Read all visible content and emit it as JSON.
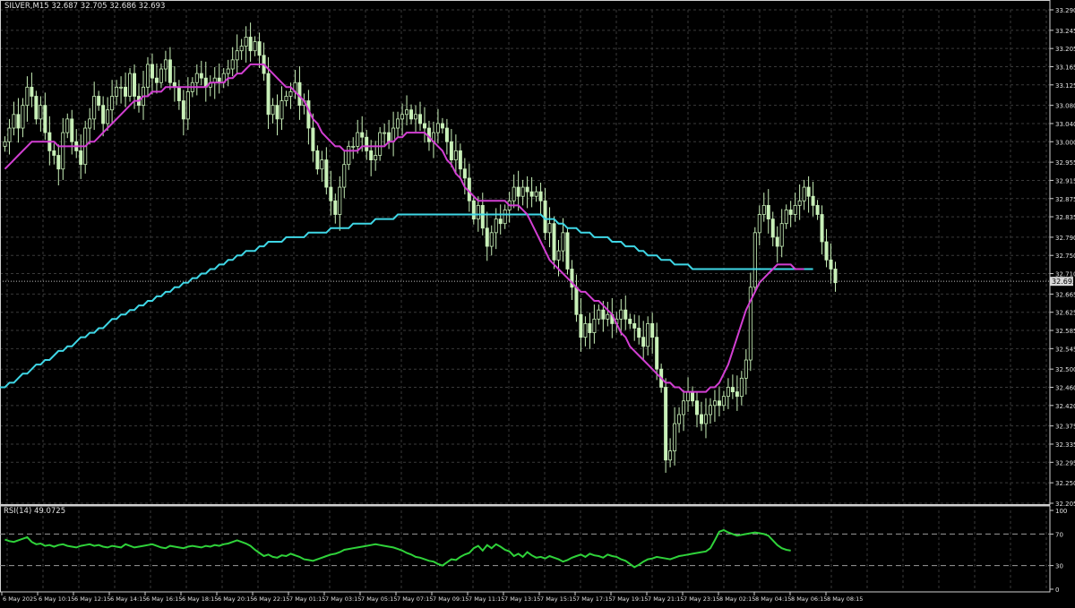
{
  "window": {
    "symbol_line": "SILVER,M15  32.687 32.705 32.686 32.693",
    "rsi_line": "RSI(14) 49.0725",
    "current_price": "32.693"
  },
  "colors": {
    "background": "#000000",
    "grid": "#3a3a3a",
    "axis_text": "#e0e0e0",
    "candle": "#c8f0b8",
    "ma_fast": "#d23fd2",
    "ma_slow": "#3fd7e6",
    "rsi_line": "#2fd23a",
    "level_line": "#9a9a9a",
    "price_tag_bg": "#d8d8d8"
  },
  "chart_data": [
    {
      "type": "candlestick",
      "title": "SILVER,M15",
      "ylim": [
        32.205,
        33.29
      ],
      "y_ticks": [
        "33.290",
        "33.245",
        "33.205",
        "33.165",
        "33.125",
        "33.080",
        "33.040",
        "33.000",
        "32.955",
        "32.915",
        "32.875",
        "32.835",
        "32.790",
        "32.750",
        "32.710",
        "32.665",
        "32.625",
        "32.585",
        "32.545",
        "32.500",
        "32.460",
        "32.420",
        "32.375",
        "32.335",
        "32.295",
        "32.250",
        "32.205"
      ],
      "x_ticks": [
        "6 May 2025",
        "6 May 10:15",
        "6 May 12:15",
        "6 May 14:15",
        "6 May 16:15",
        "6 May 18:15",
        "6 May 20:15",
        "6 May 22:15",
        "7 May 01:15",
        "7 May 03:15",
        "7 May 05:15",
        "7 May 07:15",
        "7 May 09:15",
        "7 May 11:15",
        "7 May 13:15",
        "7 May 15:15",
        "7 May 17:15",
        "7 May 19:15",
        "7 May 21:15",
        "7 May 23:15",
        "8 May 02:15",
        "8 May 04:15",
        "8 May 06:15",
        "8 May 08:15"
      ],
      "close": [
        33.0,
        33.03,
        33.06,
        33.03,
        33.08,
        33.12,
        33.1,
        33.05,
        33.08,
        33.02,
        32.98,
        32.97,
        32.94,
        33.02,
        33.05,
        33.0,
        32.98,
        32.95,
        33.03,
        33.05,
        33.1,
        33.08,
        33.04,
        33.07,
        33.1,
        33.12,
        33.12,
        33.1,
        33.15,
        33.1,
        33.08,
        33.12,
        33.17,
        33.14,
        33.13,
        33.16,
        33.18,
        33.13,
        33.12,
        33.09,
        33.05,
        33.11,
        33.13,
        33.15,
        33.14,
        33.12,
        33.13,
        33.14,
        33.13,
        33.15,
        33.16,
        33.18,
        33.2,
        33.21,
        33.23,
        33.2,
        33.22,
        33.19,
        33.15,
        33.06,
        33.08,
        33.05,
        33.09,
        33.1,
        33.11,
        33.13,
        33.08,
        33.09,
        33.03,
        32.98,
        32.94,
        32.96,
        32.9,
        32.87,
        32.84,
        32.9,
        32.95,
        32.99,
        32.99,
        33.02,
        33.01,
        32.98,
        32.96,
        32.97,
        33.02,
        33.02,
        33.0,
        33.03,
        33.05,
        33.06,
        33.07,
        33.05,
        33.06,
        33.04,
        33.03,
        33.0,
        33.02,
        33.04,
        33.03,
        33.0,
        32.96,
        32.98,
        32.94,
        32.92,
        32.87,
        32.83,
        32.86,
        32.81,
        32.77,
        32.8,
        32.83,
        32.82,
        32.85,
        32.87,
        32.9,
        32.88,
        32.9,
        32.89,
        32.88,
        32.89,
        32.87,
        32.8,
        32.82,
        32.74,
        32.76,
        32.8,
        32.72,
        32.68,
        32.62,
        32.57,
        32.6,
        32.58,
        32.61,
        32.63,
        32.61,
        32.62,
        32.6,
        32.61,
        32.63,
        32.61,
        32.6,
        32.59,
        32.57,
        32.55,
        32.6,
        32.57,
        32.5,
        32.46,
        32.3,
        32.32,
        32.38,
        32.4,
        32.43,
        32.45,
        32.43,
        32.4,
        32.38,
        32.4,
        32.42,
        32.43,
        32.42,
        32.44,
        32.46,
        32.45,
        32.44,
        32.48,
        32.52,
        32.68,
        32.8,
        32.84,
        32.86,
        32.83,
        32.79,
        32.77,
        32.82,
        32.85,
        32.84,
        32.86,
        32.87,
        32.9,
        32.88,
        32.86,
        32.84,
        32.78,
        32.74,
        32.72,
        32.69
      ],
      "ma_fast": [
        32.94,
        32.95,
        32.96,
        32.97,
        32.98,
        32.99,
        33.0,
        33.0,
        33.0,
        33.0,
        33.0,
        33.0,
        32.99,
        32.99,
        32.99,
        32.99,
        32.99,
        32.99,
        32.99,
        33.0,
        33.0,
        33.01,
        33.02,
        33.03,
        33.04,
        33.05,
        33.06,
        33.07,
        33.08,
        33.09,
        33.09,
        33.1,
        33.1,
        33.11,
        33.11,
        33.11,
        33.12,
        33.12,
        33.12,
        33.12,
        33.12,
        33.12,
        33.12,
        33.12,
        33.12,
        33.12,
        33.13,
        33.13,
        33.13,
        33.13,
        33.14,
        33.14,
        33.15,
        33.15,
        33.16,
        33.17,
        33.17,
        33.17,
        33.17,
        33.16,
        33.15,
        33.14,
        33.13,
        33.12,
        33.12,
        33.11,
        33.1,
        33.09,
        33.07,
        33.05,
        33.04,
        33.02,
        33.01,
        33.0,
        32.99,
        32.99,
        32.98,
        32.98,
        32.98,
        32.98,
        32.99,
        32.99,
        32.99,
        32.99,
        32.99,
        32.99,
        33.0,
        33.0,
        33.01,
        33.01,
        33.02,
        33.02,
        33.02,
        33.02,
        33.02,
        33.01,
        33.0,
        32.99,
        32.98,
        32.96,
        32.95,
        32.93,
        32.92,
        32.9,
        32.89,
        32.88,
        32.87,
        32.87,
        32.87,
        32.87,
        32.87,
        32.87,
        32.87,
        32.86,
        32.86,
        32.86,
        32.85,
        32.84,
        32.82,
        32.8,
        32.78,
        32.76,
        32.74,
        32.73,
        32.72,
        32.71,
        32.7,
        32.69,
        32.68,
        32.67,
        32.67,
        32.66,
        32.65,
        32.65,
        32.64,
        32.63,
        32.62,
        32.6,
        32.58,
        32.57,
        32.55,
        32.54,
        32.53,
        32.52,
        32.51,
        32.5,
        32.49,
        32.48,
        32.47,
        32.47,
        32.46,
        32.46,
        32.45,
        32.45,
        32.45,
        32.45,
        32.45,
        32.45,
        32.46,
        32.46,
        32.47,
        32.49,
        32.51,
        32.54,
        32.57,
        32.6,
        32.63,
        32.65,
        32.67,
        32.69,
        32.7,
        32.71,
        32.72,
        32.73,
        32.73,
        32.73,
        32.73,
        32.72,
        32.72,
        32.72
      ],
      "ma_slow": [
        32.46,
        32.47,
        32.47,
        32.48,
        32.49,
        32.49,
        32.5,
        32.51,
        32.51,
        32.52,
        32.52,
        32.53,
        32.54,
        32.54,
        32.55,
        32.55,
        32.56,
        32.57,
        32.57,
        32.58,
        32.58,
        32.59,
        32.59,
        32.6,
        32.61,
        32.61,
        32.62,
        32.62,
        32.63,
        32.63,
        32.64,
        32.64,
        32.65,
        32.65,
        32.66,
        32.66,
        32.67,
        32.67,
        32.68,
        32.68,
        32.69,
        32.69,
        32.7,
        32.7,
        32.71,
        32.71,
        32.72,
        32.72,
        32.73,
        32.73,
        32.74,
        32.74,
        32.75,
        32.75,
        32.76,
        32.76,
        32.76,
        32.77,
        32.77,
        32.78,
        32.78,
        32.78,
        32.78,
        32.79,
        32.79,
        32.79,
        32.79,
        32.79,
        32.8,
        32.8,
        32.8,
        32.8,
        32.8,
        32.81,
        32.81,
        32.81,
        32.81,
        32.81,
        32.82,
        32.82,
        32.82,
        32.82,
        32.82,
        32.83,
        32.83,
        32.83,
        32.83,
        32.83,
        32.84,
        32.84,
        32.84,
        32.84,
        32.84,
        32.84,
        32.84,
        32.84,
        32.84,
        32.84,
        32.84,
        32.84,
        32.84,
        32.84,
        32.84,
        32.84,
        32.84,
        32.84,
        32.84,
        32.84,
        32.84,
        32.84,
        32.84,
        32.84,
        32.84,
        32.84,
        32.84,
        32.84,
        32.84,
        32.84,
        32.84,
        32.84,
        32.84,
        32.83,
        32.83,
        32.83,
        32.82,
        32.82,
        32.81,
        32.81,
        32.81,
        32.8,
        32.8,
        32.8,
        32.79,
        32.79,
        32.79,
        32.79,
        32.78,
        32.78,
        32.78,
        32.77,
        32.77,
        32.77,
        32.76,
        32.76,
        32.75,
        32.75,
        32.75,
        32.74,
        32.74,
        32.74,
        32.73,
        32.73,
        32.73,
        32.73,
        32.72,
        32.72,
        32.72,
        32.72,
        32.72,
        32.72,
        32.72,
        32.72,
        32.72,
        32.72,
        32.72,
        32.72,
        32.72,
        32.72,
        32.72,
        32.72,
        32.72,
        32.72,
        32.72,
        32.72,
        32.72,
        32.72,
        32.72,
        32.72,
        32.72,
        32.72,
        32.72,
        32.72
      ],
      "current_price": 32.693
    },
    {
      "type": "line",
      "title": "RSI(14) 49.0725",
      "ylim": [
        0,
        100
      ],
      "y_ticks": [
        "100",
        "70",
        "30",
        "0"
      ],
      "levels": [
        70,
        30
      ],
      "values": [
        63,
        61,
        60,
        62,
        64,
        66,
        60,
        57,
        58,
        55,
        56,
        54,
        56,
        57,
        55,
        54,
        53,
        55,
        56,
        57,
        55,
        56,
        54,
        53,
        55,
        54,
        53,
        57,
        55,
        53,
        54,
        55,
        56,
        57,
        55,
        53,
        52,
        55,
        54,
        53,
        52,
        54,
        55,
        54,
        53,
        55,
        54,
        56,
        55,
        57,
        58,
        60,
        62,
        60,
        58,
        55,
        50,
        46,
        42,
        44,
        41,
        40,
        43,
        42,
        45,
        43,
        41,
        38,
        37,
        36,
        38,
        40,
        42,
        44,
        45,
        47,
        50,
        51,
        52,
        53,
        54,
        55,
        56,
        57,
        56,
        55,
        54,
        53,
        51,
        49,
        46,
        44,
        41,
        40,
        38,
        36,
        35,
        32,
        30,
        34,
        38,
        37,
        41,
        44,
        46,
        52,
        55,
        49,
        56,
        52,
        57,
        54,
        50,
        48,
        42,
        45,
        41,
        47,
        43,
        40,
        41,
        39,
        42,
        40,
        38,
        35,
        37,
        40,
        42,
        44,
        41,
        45,
        43,
        42,
        40,
        44,
        42,
        41,
        38,
        36,
        32,
        28,
        31,
        35,
        38,
        39,
        41,
        40,
        39,
        38,
        40,
        42,
        43,
        44,
        45,
        46,
        47,
        48,
        52,
        62,
        73,
        75,
        72,
        70,
        68,
        69,
        70,
        71,
        72,
        71,
        70,
        68,
        62,
        56,
        52,
        50,
        49
      ],
      "current_value": 49.0725
    }
  ]
}
